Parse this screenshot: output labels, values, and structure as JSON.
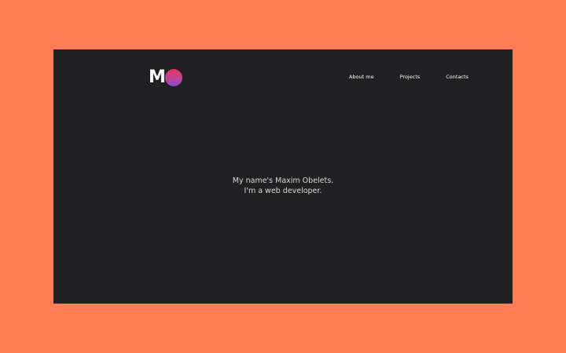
{
  "logo": {
    "letter": "M",
    "circle_gradient": [
      "#e0385f",
      "#8a4dd0"
    ]
  },
  "nav": {
    "items": [
      {
        "label": "About me"
      },
      {
        "label": "Projects"
      },
      {
        "label": "Contacts"
      }
    ]
  },
  "hero": {
    "line1": "My name's Maxim Obelets.",
    "line2": "I'm a web developer."
  },
  "colors": {
    "page_background": "#ff7d55",
    "frame_background": "#202022",
    "text": "#ffffff",
    "hero_text": "#d9d9d9"
  }
}
